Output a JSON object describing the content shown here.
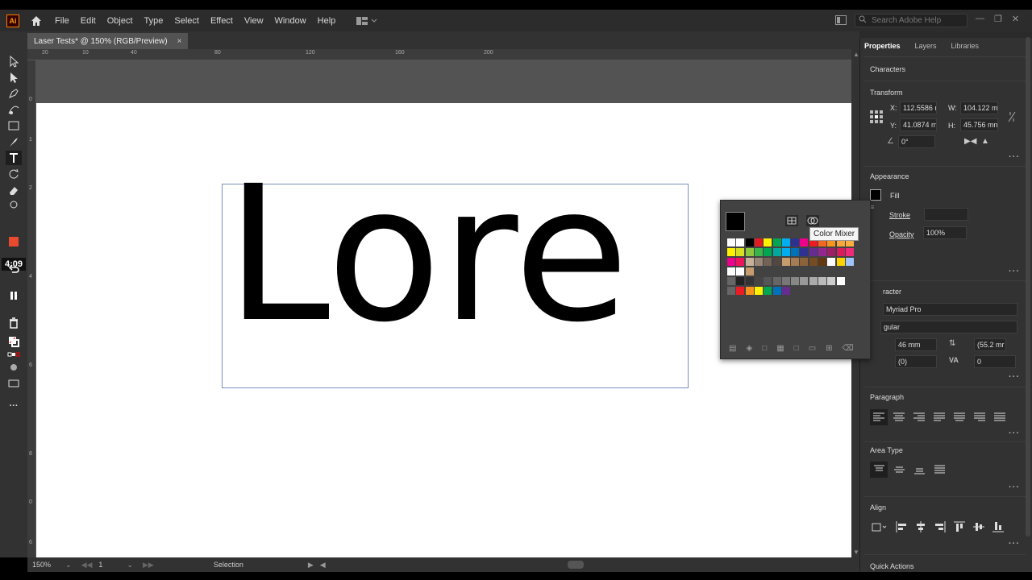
{
  "menubar": {
    "app_logo": "Ai",
    "items": [
      "File",
      "Edit",
      "Object",
      "Type",
      "Select",
      "Effect",
      "View",
      "Window",
      "Help"
    ],
    "search_placeholder": "Search Adobe Help"
  },
  "document": {
    "tab_title": "Laser Tests* @ 150% (RGB/Preview)",
    "close": "×",
    "text_content": "Lore"
  },
  "toolbar": {
    "timer": "4:09"
  },
  "rulers": {
    "h": [
      "20",
      "10",
      "40",
      "80",
      "120",
      "160",
      "200"
    ],
    "v": [
      "0",
      "1",
      "2",
      "4",
      "6",
      "8",
      "0",
      "6"
    ]
  },
  "status": {
    "zoom": "150%",
    "artboard": "1",
    "tool": "Selection"
  },
  "swatches": {
    "tooltip": "Color Mixer"
  },
  "properties": {
    "tabs": [
      "Properties",
      "Layers",
      "Libraries"
    ],
    "selection_type": "Characters",
    "transform": {
      "title": "Transform",
      "x_label": "X:",
      "x": "112.5586 r",
      "y_label": "Y:",
      "y": "41.0874 m",
      "w_label": "W:",
      "w": "104.122 m",
      "h_label": "H:",
      "h": "45.756 mn",
      "angle": "0°"
    },
    "appearance": {
      "title": "Appearance",
      "fill_label": "Fill",
      "stroke_label": "Stroke",
      "opacity_label": "Opacity",
      "opacity": "100%"
    },
    "character": {
      "title": "racter",
      "font": "Myriad Pro",
      "style": "gular",
      "size": "46 mm",
      "leading": "(55.2 mr",
      "kerning": "(0)",
      "tracking": "0"
    },
    "paragraph_title": "Paragraph",
    "area_type_title": "Area Type",
    "align_title": "Align",
    "quick_actions_title": "Quick Actions"
  }
}
